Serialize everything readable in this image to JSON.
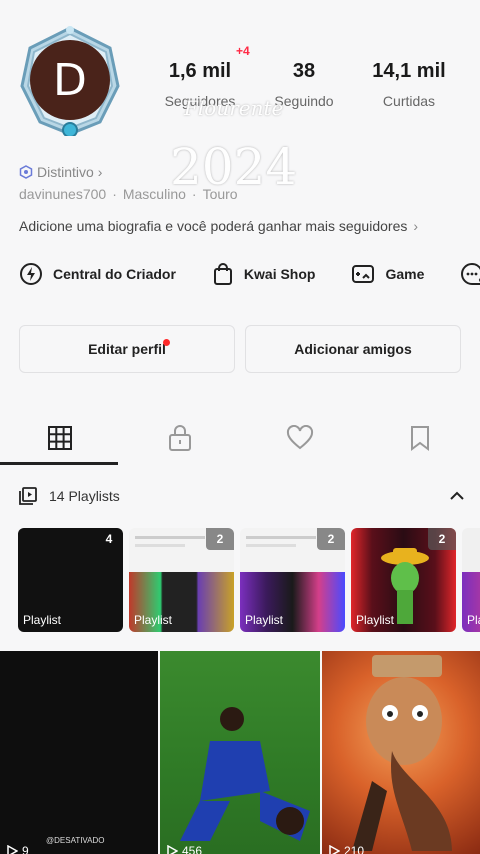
{
  "profile": {
    "avatar_letter": "D",
    "username": "davinunes700",
    "gender": "Masculino",
    "sign": "Touro",
    "badge_label": "Distintivo",
    "bio": "Adicione uma biografia e você poderá ganhar mais seguidores"
  },
  "overlay": {
    "name_text": "Flourente",
    "year_text": "2024"
  },
  "stats": {
    "followers": {
      "value": "1,6 mil",
      "label": "Seguidores",
      "delta": "+4"
    },
    "following": {
      "value": "38",
      "label": "Seguindo"
    },
    "likes": {
      "value": "14,1 mil",
      "label": "Curtidas"
    }
  },
  "shortcuts": [
    {
      "label": "Central do Criador",
      "icon": "lightning-circle-icon"
    },
    {
      "label": "Kwai Shop",
      "icon": "shopping-bag-icon"
    },
    {
      "label": "Game",
      "icon": "gamepad-icon"
    },
    {
      "label": "",
      "icon": "chat-bubble-icon"
    }
  ],
  "actions": {
    "edit_profile": "Editar perfil",
    "add_friends": "Adicionar amigos"
  },
  "tabs": [
    {
      "icon": "grid-icon",
      "active": true
    },
    {
      "icon": "lock-icon",
      "active": false
    },
    {
      "icon": "heart-icon",
      "active": false
    },
    {
      "icon": "bookmark-icon",
      "active": false
    }
  ],
  "playlists_section": {
    "title": "14 Playlists",
    "items": [
      {
        "name": "Playlist",
        "count": "4"
      },
      {
        "name": "Playlist",
        "count": "2"
      },
      {
        "name": "Playlist",
        "count": "2"
      },
      {
        "name": "Playlist",
        "count": "2"
      },
      {
        "name": "Pla",
        "count": ""
      }
    ]
  },
  "videos": [
    {
      "views": "9",
      "watermark": "@DESATIVADO"
    },
    {
      "views": "456"
    },
    {
      "views": "210"
    }
  ],
  "colors": {
    "background": "#f7f7f8",
    "accent_red": "#ff2a45",
    "avatar_bg": "#4a231a"
  }
}
